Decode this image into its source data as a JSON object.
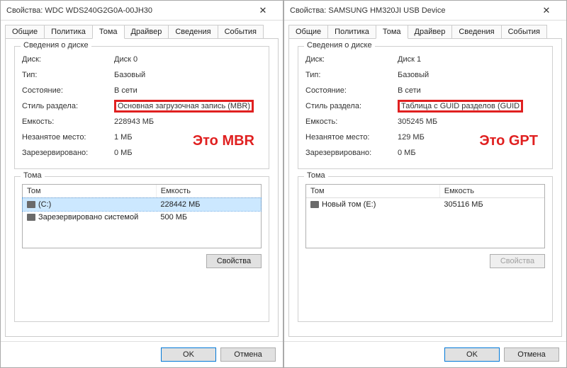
{
  "left": {
    "title": "Свойства: WDC WDS240G2G0A-00JH30",
    "tabs": [
      "Общие",
      "Политика",
      "Тома",
      "Драйвер",
      "Сведения",
      "События"
    ],
    "active_tab": "Тома",
    "info_group_title": "Сведения о диске",
    "rows": {
      "disk_lbl": "Диск:",
      "disk_val": "Диск 0",
      "type_lbl": "Тип:",
      "type_val": "Базовый",
      "state_lbl": "Состояние:",
      "state_val": "В сети",
      "style_lbl": "Стиль раздела:",
      "style_val": "Основная загрузочная запись (MBR)",
      "cap_lbl": "Емкость:",
      "cap_val": "228943 МБ",
      "free_lbl": "Незанятое место:",
      "free_val": "1 МБ",
      "res_lbl": "Зарезервировано:",
      "res_val": "0 МБ"
    },
    "annotation": "Это MBR",
    "vol_group_title": "Тома",
    "vol_headers": {
      "name": "Том",
      "cap": "Емкость"
    },
    "volumes": [
      {
        "name": "(C:)",
        "cap": "228442 МБ",
        "selected": true
      },
      {
        "name": "Зарезервировано системой",
        "cap": "500 МБ",
        "selected": false
      }
    ],
    "props_btn": "Свойства",
    "ok": "OK",
    "cancel": "Отмена"
  },
  "right": {
    "title": "Свойства: SAMSUNG HM320JI USB Device",
    "tabs": [
      "Общие",
      "Политика",
      "Тома",
      "Драйвер",
      "Сведения",
      "События"
    ],
    "active_tab": "Тома",
    "info_group_title": "Сведения о диске",
    "rows": {
      "disk_lbl": "Диск:",
      "disk_val": "Диск 1",
      "type_lbl": "Тип:",
      "type_val": "Базовый",
      "state_lbl": "Состояние:",
      "state_val": "В сети",
      "style_lbl": "Стиль раздела:",
      "style_val": "Таблица с GUID разделов (GUID",
      "cap_lbl": "Емкость:",
      "cap_val": "305245 МБ",
      "free_lbl": "Незанятое место:",
      "free_val": "129 МБ",
      "res_lbl": "Зарезервировано:",
      "res_val": "0 МБ"
    },
    "annotation": "Это GPT",
    "vol_group_title": "Тома",
    "vol_headers": {
      "name": "Том",
      "cap": "Емкость"
    },
    "volumes": [
      {
        "name": "Новый том (E:)",
        "cap": "305116 МБ",
        "selected": false
      }
    ],
    "props_btn": "Свойства",
    "ok": "OK",
    "cancel": "Отмена"
  }
}
